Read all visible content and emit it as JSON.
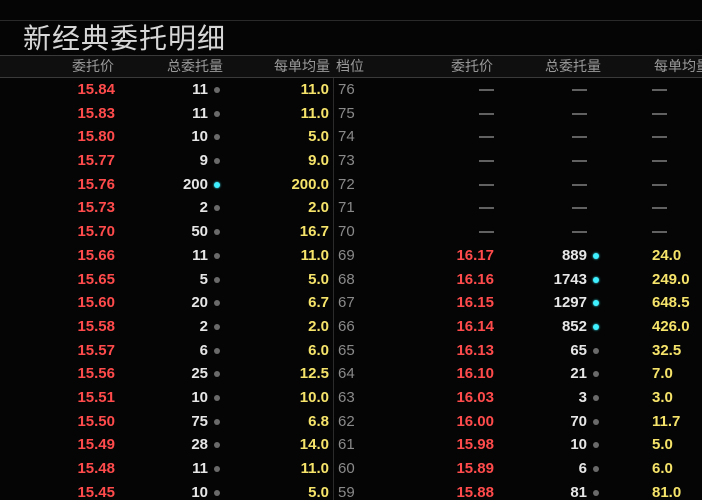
{
  "window": {
    "title": "新经典委托明细"
  },
  "header": {
    "left_price": "委托价",
    "left_total": "总委托量",
    "left_avg": "每单均量",
    "level": "档位",
    "right_price": "委托价",
    "right_total": "总委托量",
    "right_avg": "每单均量"
  },
  "rows": [
    {
      "lp": "15.84",
      "lt": "11",
      "lh": false,
      "la": "11.0",
      "lv": "76",
      "rp": "—",
      "rt": "—",
      "rh": null,
      "ra": "—"
    },
    {
      "lp": "15.83",
      "lt": "11",
      "lh": false,
      "la": "11.0",
      "lv": "75",
      "rp": "—",
      "rt": "—",
      "rh": null,
      "ra": "—"
    },
    {
      "lp": "15.80",
      "lt": "10",
      "lh": false,
      "la": "5.0",
      "lv": "74",
      "rp": "—",
      "rt": "—",
      "rh": null,
      "ra": "—"
    },
    {
      "lp": "15.77",
      "lt": "9",
      "lh": false,
      "la": "9.0",
      "lv": "73",
      "rp": "—",
      "rt": "—",
      "rh": null,
      "ra": "—"
    },
    {
      "lp": "15.76",
      "lt": "200",
      "lh": true,
      "la": "200.0",
      "lv": "72",
      "rp": "—",
      "rt": "—",
      "rh": null,
      "ra": "—"
    },
    {
      "lp": "15.73",
      "lt": "2",
      "lh": false,
      "la": "2.0",
      "lv": "71",
      "rp": "—",
      "rt": "—",
      "rh": null,
      "ra": "—"
    },
    {
      "lp": "15.70",
      "lt": "50",
      "lh": false,
      "la": "16.7",
      "lv": "70",
      "rp": "—",
      "rt": "—",
      "rh": null,
      "ra": "—"
    },
    {
      "lp": "15.66",
      "lt": "11",
      "lh": false,
      "la": "11.0",
      "lv": "69",
      "rp": "16.17",
      "rt": "889",
      "rh": true,
      "ra": "24.0"
    },
    {
      "lp": "15.65",
      "lt": "5",
      "lh": false,
      "la": "5.0",
      "lv": "68",
      "rp": "16.16",
      "rt": "1743",
      "rh": true,
      "ra": "249.0"
    },
    {
      "lp": "15.60",
      "lt": "20",
      "lh": false,
      "la": "6.7",
      "lv": "67",
      "rp": "16.15",
      "rt": "1297",
      "rh": true,
      "ra": "648.5"
    },
    {
      "lp": "15.58",
      "lt": "2",
      "lh": false,
      "la": "2.0",
      "lv": "66",
      "rp": "16.14",
      "rt": "852",
      "rh": true,
      "ra": "426.0"
    },
    {
      "lp": "15.57",
      "lt": "6",
      "lh": false,
      "la": "6.0",
      "lv": "65",
      "rp": "16.13",
      "rt": "65",
      "rh": false,
      "ra": "32.5"
    },
    {
      "lp": "15.56",
      "lt": "25",
      "lh": false,
      "la": "12.5",
      "lv": "64",
      "rp": "16.10",
      "rt": "21",
      "rh": false,
      "ra": "7.0"
    },
    {
      "lp": "15.51",
      "lt": "10",
      "lh": false,
      "la": "10.0",
      "lv": "63",
      "rp": "16.03",
      "rt": "3",
      "rh": false,
      "ra": "3.0"
    },
    {
      "lp": "15.50",
      "lt": "75",
      "lh": false,
      "la": "6.8",
      "lv": "62",
      "rp": "16.00",
      "rt": "70",
      "rh": false,
      "ra": "11.7"
    },
    {
      "lp": "15.49",
      "lt": "28",
      "lh": false,
      "la": "14.0",
      "lv": "61",
      "rp": "15.98",
      "rt": "10",
      "rh": false,
      "ra": "5.0"
    },
    {
      "lp": "15.48",
      "lt": "11",
      "lh": false,
      "la": "11.0",
      "lv": "60",
      "rp": "15.89",
      "rt": "6",
      "rh": false,
      "ra": "6.0"
    },
    {
      "lp": "15.45",
      "lt": "10",
      "lh": false,
      "la": "5.0",
      "lv": "59",
      "rp": "15.88",
      "rt": "81",
      "rh": false,
      "ra": "81.0"
    }
  ],
  "colors": {
    "background": "#050505",
    "price_red": "#ff4b4b",
    "avg_yellow": "#f5e36a",
    "highlight_dot": "#3ff0ff",
    "normal_dot": "#6a6a6a"
  }
}
